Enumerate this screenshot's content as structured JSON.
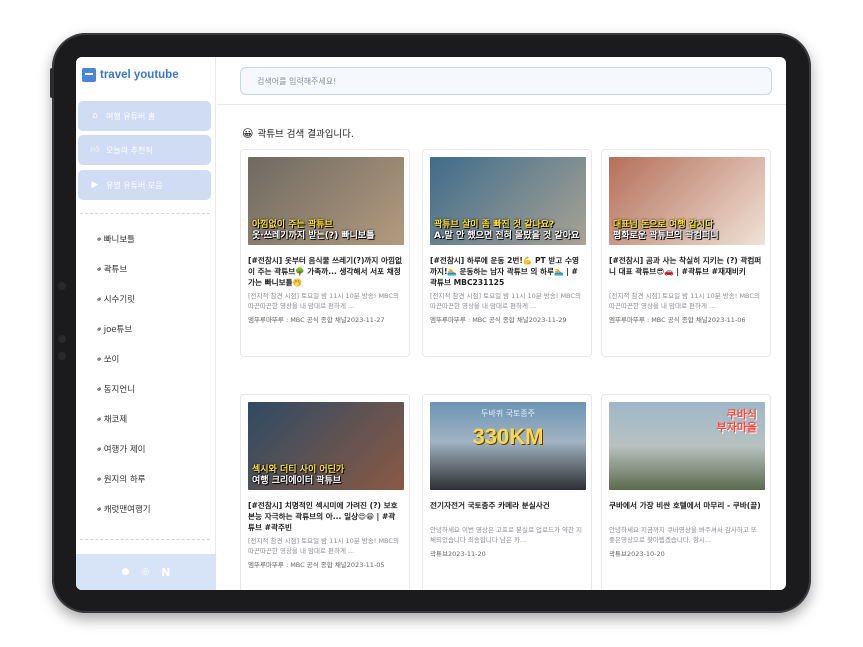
{
  "app": {
    "brand": "travel youtube"
  },
  "search": {
    "placeholder": "검색어를 입력해주세요!"
  },
  "sidebar": {
    "nav": [
      {
        "label": "여행 유튜버 홈",
        "icon": "home-icon"
      },
      {
        "label": "오늘의 추천픽",
        "icon": "thumbs-up-icon"
      },
      {
        "label": "유명 유튜버 모음",
        "icon": "youtube-icon"
      }
    ],
    "channels": [
      "빠니보틀",
      "곽튜브",
      "시수기릿",
      "joe튜브",
      "쏘이",
      "동지언니",
      "채코제",
      "여행가 제이",
      "원지의 하루",
      "캐럿맨여행기"
    ],
    "footer_icons": [
      "github-icon",
      "instagram-icon",
      "notion-icon"
    ]
  },
  "results": {
    "emoji": "😀",
    "title": "곽튜브 검색 결과입니다."
  },
  "cards": [
    {
      "title": "[#전참시] 옷부터 음식물 쓰레기(?)까지 아낌없이 주는 곽튜브🌳 가족까... 생각해서 서포 채정가는 빠니보틀🤭",
      "desc": "[전지적 참견 시점] 토요일 밤 11시 10분 방송! MBC의 따끈따끈한 영상을 내 맘대로 편하게 ...",
      "channel": "엠뚜루마뚜루 : MBC 공식 종합 채널",
      "date": "2023-11-27",
      "thumb_caption_1": "아낌없이 주는 곽튜브",
      "thumb_caption_2": "옷·쓰레기까지 받는(?) 빠니보틀",
      "thumb_colors": [
        "#6e6a63",
        "#b39a7e"
      ]
    },
    {
      "title": "[#전참시] 하루에 운동 2번!💪 PT 받고 수영까지!🏊 운동하는 남자 곽튜브 의 하루🏊 | #곽튜브 MBC231125",
      "desc": "[전지적 참견 시점] 토요일 밤 11시 10분 방송! MBC의 따끈따끈한 영상을 내 맘대로 편하게 ...",
      "channel": "엠뚜루마뚜루 : MBC 공식 종합 채널",
      "date": "2023-11-29",
      "thumb_caption_1": "곽튜브 살이 좀 빠진 것 같나요?",
      "thumb_caption_2": "A.말 안 했으면 전혀 몰랐을 것 같아요",
      "thumb_colors": [
        "#3f6c8a",
        "#a8a394"
      ]
    },
    {
      "title": "[#전참시] 곰과 사는 착실히 지키는 (?) 곽컴퍼니 대표 곽튜브😎🚗 | #곽튜브 #재재비키",
      "desc": "[전지적 참견 시점] 토요일 밤 11시 10분 방송! MBC의 따끈따끈한 영상을 내 맘대로 편하게 ...",
      "channel": "엠뚜루마뚜루 : MBC 공식 종합 채널",
      "date": "2023-11-06",
      "thumb_caption_1": "대표님 돈으로 여행 갑시다",
      "thumb_caption_2": "평화로운 곽튜브의 곽컴퍼니",
      "thumb_colors": [
        "#b56f5a",
        "#efe2d6"
      ]
    },
    {
      "title": "[#전참시] 치명적인 섹시미에 가려진 (?) 보호본능 자극하는 곽튜브의 아... 일상😍😁 | #곽튜브 #곽주빈",
      "desc": "[전지적 참견 시점] 토요일 밤 11시 10분 방송! MBC의 따끈따끈한 영상을 내 맘대로 편하게 ...",
      "channel": "엠뚜루마뚜루 : MBC 공식 종합 채널",
      "date": "2023-11-05",
      "thumb_caption_1": "섹시와 더티 사이 어딘가",
      "thumb_caption_2": "여행 크리에이터 곽튜브",
      "thumb_colors": [
        "#2f4a63",
        "#8a5a44"
      ]
    },
    {
      "title": "전기자전거 국토종주 카메라 분실사건",
      "desc": "안녕하세요 이번 영상은 고프로 분실로 업로드가 약간 지체되었습니다 죄송합니다 남은 카...",
      "channel": "곽튜브",
      "date": "2023-11-20",
      "thumb_top": "두바퀴 국토종주",
      "thumb_big": "330KM",
      "thumb_colors": [
        "#6d94b5",
        "#2e2f33"
      ]
    },
    {
      "title": "쿠바에서 가장 비싼 호텔에서 마무리 - 쿠바(끝)",
      "desc": "안녕하세요 지금까지 쿠바영상을 봐주셔서 감사하고 또 좋은영상으로 찾아뵙겠습니다. 항시...",
      "channel": "곽튜브",
      "date": "2023-10-20",
      "thumb_red_1": "쿠바식",
      "thumb_red_2": "부자마을",
      "thumb_colors": [
        "#9fb6c9",
        "#5b6a4e"
      ]
    }
  ]
}
